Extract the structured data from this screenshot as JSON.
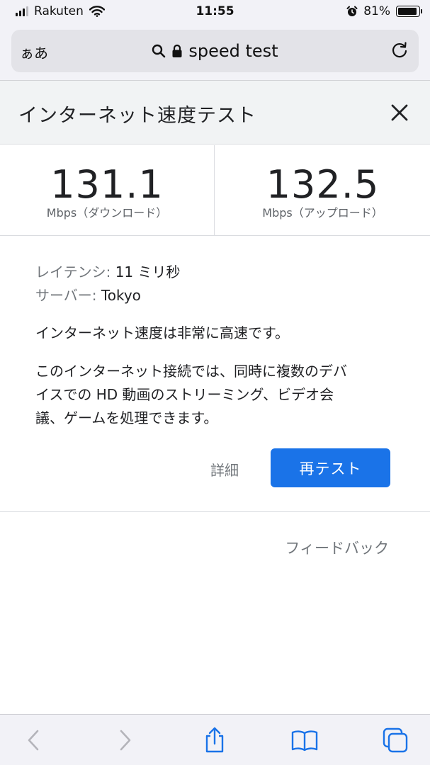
{
  "status_bar": {
    "carrier": "Rakuten",
    "time": "11:55",
    "battery": "81%"
  },
  "address_bar": {
    "text_size_label": "ぁあ",
    "url_text": "speed test"
  },
  "panel": {
    "title": "インターネット速度テスト"
  },
  "speeds": {
    "download": {
      "value": "131.1",
      "unit": "Mbps（ダウンロード）"
    },
    "upload": {
      "value": "132.5",
      "unit": "Mbps（アップロード）"
    }
  },
  "results": {
    "latency_label": "レイテンシ:",
    "latency_value": "11 ミリ秒",
    "server_label": "サーバー:",
    "server_value": "Tokyo",
    "summary": "インターネット速度は非常に高速です。",
    "description_line1": "このインターネット接続では、同時に複数のデバ",
    "description_line2": "イスでの HD 動画のストリーミング、ビデオ会",
    "description_line3": "議、ゲームを処理できます。"
  },
  "actions": {
    "details_label": "詳細",
    "retest_label": "再テスト",
    "feedback_label": "フィードバック"
  },
  "colors": {
    "accent": "#1a73e8",
    "secondary_text": "#70757a"
  }
}
